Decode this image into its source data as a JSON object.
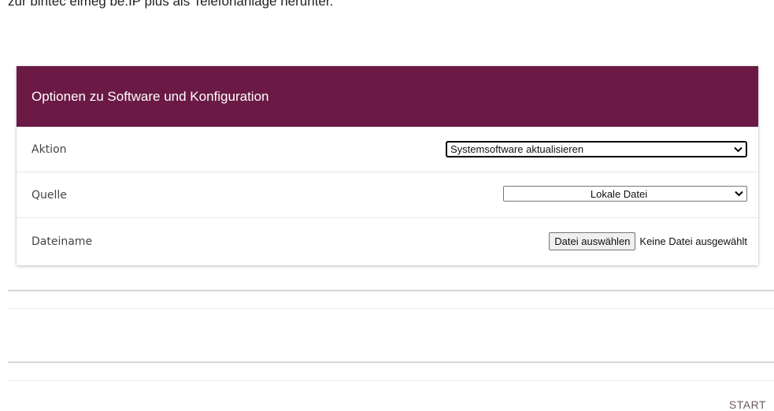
{
  "intro": {
    "text": "zur bintec elmeg be.IP plus als Telefonanlage herunter."
  },
  "panel": {
    "title": "Optionen zu Software und Konfiguration",
    "rows": [
      {
        "label": "Aktion",
        "value": "Systemsoftware aktualisieren"
      },
      {
        "label": "Quelle",
        "value": "Lokale Datei"
      },
      {
        "label": "Dateiname",
        "button_label": "Datei auswählen",
        "status": "Keine Datei ausgewählt"
      }
    ]
  },
  "actions": {
    "start_label": "START"
  },
  "colors": {
    "header_bg": "#6b1a45",
    "header_text": "#ffffff"
  },
  "icons": {
    "dropdown": "chevron-down-icon"
  }
}
